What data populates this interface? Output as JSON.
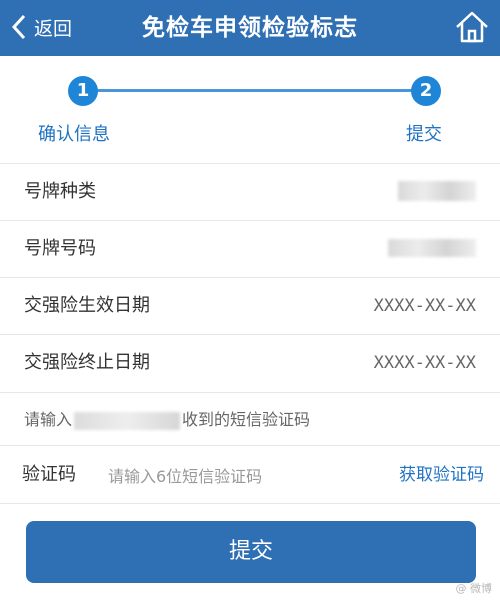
{
  "header": {
    "back_label": "返回",
    "title": "免检车申领检验标志"
  },
  "stepper": {
    "steps": [
      {
        "number": "1",
        "label": "确认信息"
      },
      {
        "number": "2",
        "label": "提交"
      }
    ]
  },
  "info_rows": [
    {
      "label": "号牌种类",
      "value": ""
    },
    {
      "label": "号牌号码",
      "value": ""
    },
    {
      "label": "交强险生效日期",
      "value": "XXXX-XX-XX"
    },
    {
      "label": "交强险终止日期",
      "value": "XXXX-XX-XX"
    }
  ],
  "sms": {
    "hint_prefix": "请输入",
    "hint_suffix": "收到的短信验证码",
    "code_label": "验证码",
    "code_placeholder": "请输入6位短信验证码",
    "get_code_label": "获取验证码"
  },
  "submit_label": "提交",
  "colors": {
    "primary": "#2f6fb4",
    "step_dot": "#1f86d7",
    "link": "#1f72c4"
  },
  "icons": {
    "back": "chevron-left-icon",
    "home": "home-icon"
  }
}
